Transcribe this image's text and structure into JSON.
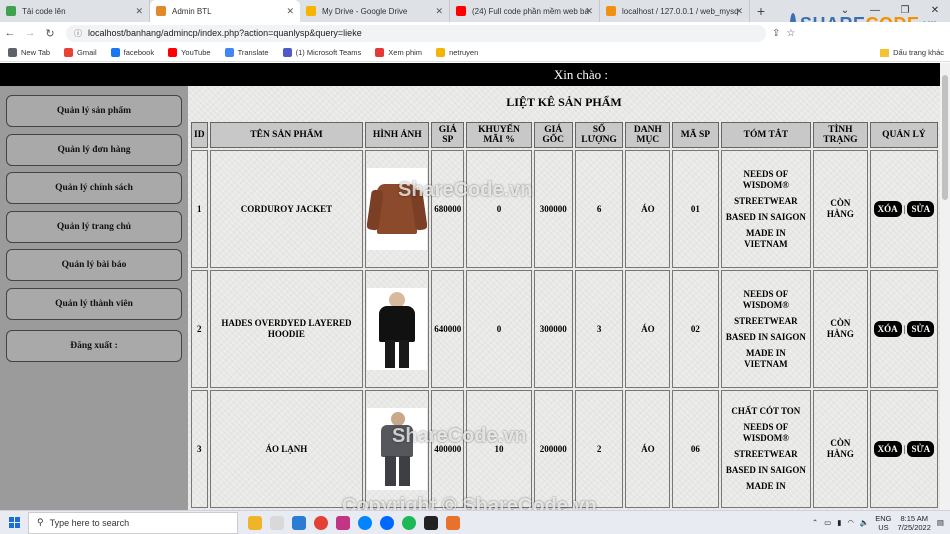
{
  "browser": {
    "tabs": [
      {
        "title": "Tải code lên",
        "color": "#3fa34d",
        "active": false
      },
      {
        "title": "Admin BTL",
        "color": "#e08a2c",
        "active": true
      },
      {
        "title": "My Drive - Google Drive",
        "color": "#f4b400",
        "active": false
      },
      {
        "title": "(24) Full code phần mềm web bá",
        "color": "#ff0000",
        "active": false
      },
      {
        "title": "localhost / 127.0.0.1 / web_mysq",
        "color": "#f29111",
        "active": false
      }
    ],
    "new_tab_glyph": "+",
    "url": "localhost/banhang/admincp/index.php?action=quanlysp&query=lieke",
    "bookmarks": [
      "New Tab",
      "Gmail",
      "facebook",
      "YouTube",
      "Translate",
      "(1) Microsoft Teams",
      "Xem phim",
      "netruyen"
    ],
    "bookmark_colors": [
      "#5f6368",
      "#ea4335",
      "#1877f2",
      "#ff0000",
      "#4285f4",
      "#5059c9",
      "#e53935",
      "#f4b400"
    ],
    "bookmarks_right": "Dấu trang khác",
    "watermark_logo": {
      "part1": "SHARE",
      "part2": "CODE",
      "suffix": ".vn"
    }
  },
  "site": {
    "greeting": "Xin chào :",
    "menu": [
      "Quản lý sản phẩm",
      "Quản lý đơn hàng",
      "Quản lý chính sách",
      "Quản lý trang chủ",
      "Quản lý bài báo",
      "Quản lý thành viên",
      "Đăng xuất :"
    ],
    "heading": "LIỆT KÊ SẢN PHẨM",
    "columns": [
      "ID",
      "TÊN SẢN PHẨM",
      "HÌNH ẢNH",
      "GIÁ SP",
      "KHUYẾN MÃI %",
      "GIÁ GỐC",
      "SỐ LƯỢNG",
      "DANH MỤC",
      "MÃ SP",
      "TÓM TẮT",
      "TÌNH TRẠNG",
      "QUẢN LÝ"
    ],
    "rows": [
      {
        "id": "1",
        "name": "CORDUROY JACKET",
        "price": "680000",
        "discount": "0",
        "original": "300000",
        "qty": "6",
        "category": "ÁO",
        "code": "01",
        "summary": [
          "NEEDS OF WISDOM®",
          "STREETWEAR",
          "BASED IN SAIGON",
          "MADE IN VIETNAM"
        ],
        "status": "CÒN HÀNG",
        "image": "brown-jacket-image"
      },
      {
        "id": "2",
        "name": "HADES OVERDYED LAYERED HOODIE",
        "price": "640000",
        "discount": "0",
        "original": "300000",
        "qty": "3",
        "category": "ÁO",
        "code": "02",
        "summary": [
          "NEEDS OF WISDOM®",
          "STREETWEAR",
          "BASED IN SAIGON",
          "MADE IN VIETNAM"
        ],
        "status": "CÒN HÀNG",
        "image": "black-hoodie-image"
      },
      {
        "id": "3",
        "name": "ÁO LẠNH",
        "price": "400000",
        "discount": "10",
        "original": "200000",
        "qty": "2",
        "category": "ÁO",
        "code": "06",
        "summary": [
          "CHẤT CÓT TON",
          "NEEDS OF WISDOM®",
          "STREETWEAR",
          "BASED IN SAIGON",
          "MADE IN"
        ],
        "status": "CÒN HÀNG",
        "image": "grey-outfit-image"
      }
    ],
    "delete_label": "XÓA",
    "edit_label": "SỬA",
    "action_separator": "|"
  },
  "watermarks": {
    "center": "ShareCode.vn",
    "bottom": "Copyright © ShareCode.vn"
  },
  "taskbar": {
    "search_placeholder": "Type here to search",
    "language": "ENG",
    "region": "US",
    "time": "8:15 AM",
    "date": "7/25/2022"
  }
}
